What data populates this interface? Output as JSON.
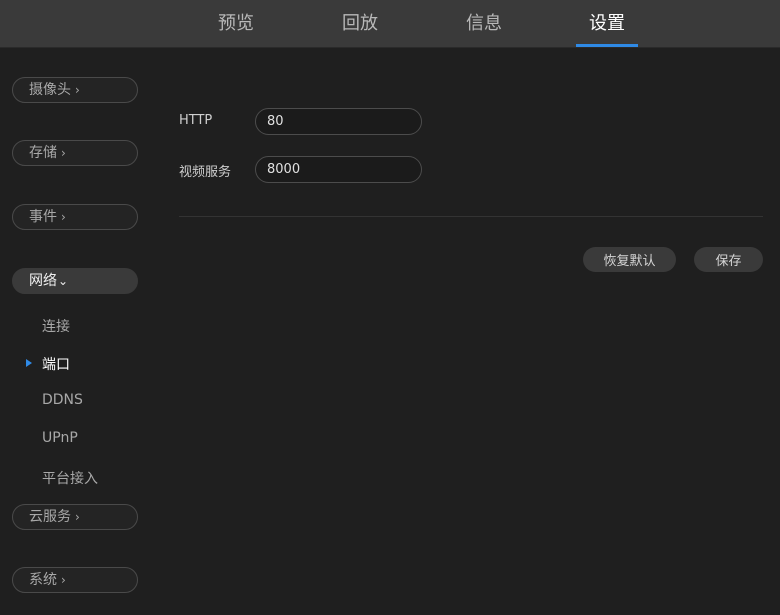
{
  "nav": {
    "tabs": [
      {
        "label": "预览"
      },
      {
        "label": "回放"
      },
      {
        "label": "信息"
      },
      {
        "label": "设置"
      }
    ],
    "active_tab": "设置"
  },
  "sidebar": {
    "camera": "摄像头",
    "storage": "存储",
    "event": "事件",
    "network": "网络",
    "network_items": [
      "连接",
      "端口",
      "DDNS",
      "UPnP",
      "平台接入"
    ],
    "active_item": "端口",
    "cloud": "云服务",
    "system": "系统",
    "chevron_right": "›",
    "chevron_down": "⌄"
  },
  "form": {
    "http_label": "HTTP",
    "http_value": "80",
    "video_label": "视频服务",
    "video_value": "8000"
  },
  "actions": {
    "restore_default": "恢复默认",
    "save": "保存"
  },
  "colors": {
    "accent": "#2f8ae6",
    "background": "#1f1f1f",
    "topbar": "#3a3a3a"
  }
}
